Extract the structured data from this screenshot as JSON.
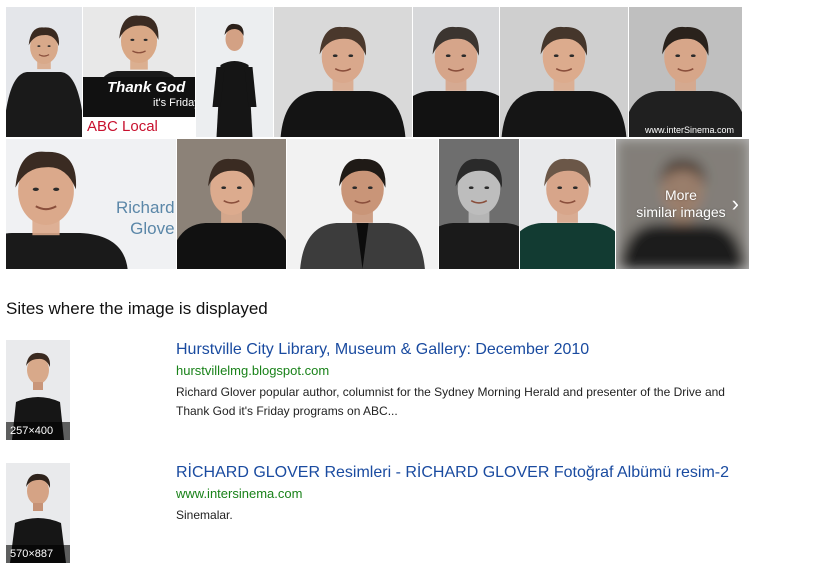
{
  "grid": {
    "row1": [
      {
        "bg": "#e4e6ea",
        "hair": "#3a2a20",
        "shirt": "#1a1a1a",
        "skin": "#d8a98a",
        "type": "half"
      },
      {
        "bg": "#e8e8e8",
        "hair": "#3b2b22",
        "shirt": "#1a1a1a",
        "skin": "#d9a886",
        "type": "abc",
        "overlay_title": "Thank God",
        "overlay_sub": "it's Friday",
        "overlay_logo": "ABC Local"
      },
      {
        "bg": "#eceef0",
        "hair": "#2c211b",
        "shirt": "#151515",
        "skin": "#d3a184",
        "type": "full"
      },
      {
        "bg": "#d9d9d9",
        "hair": "#4a382c",
        "shirt": "#141414",
        "skin": "#d9a88c",
        "type": "close"
      },
      {
        "bg": "#d7d8da",
        "hair": "#3c3530",
        "shirt": "#121212",
        "skin": "#d6a58a",
        "type": "close"
      },
      {
        "bg": "#cfcfcf",
        "hair": "#45362b",
        "shirt": "#151515",
        "skin": "#dcab8d",
        "type": "close"
      },
      {
        "bg": "#bfbfbf",
        "hair": "#2a221c",
        "shirt": "#202020",
        "skin": "#d7a689",
        "type": "close",
        "watermark": "www.interSinema.com"
      }
    ],
    "row2": [
      {
        "bg": "#f0f1f3",
        "hair": "#3a2b22",
        "shirt": "#1a1a1a",
        "skin": "#dba98b",
        "type": "name",
        "name_text": "Richard\nGlove"
      },
      {
        "bg": "#8c8278",
        "hair": "#3a2b22",
        "shirt": "#111111",
        "skin": "#dcab8e",
        "type": "close"
      },
      {
        "bg": "#f2f2f2",
        "hair": "#1f1a16",
        "shirt": "#3c3c3c",
        "skin": "#c99578",
        "type": "suit"
      },
      {
        "bg": "#6e6e6e",
        "hair": "#2a2a2a",
        "shirt": "#1a1a1a",
        "skin": "#bdbdbd",
        "type": "close"
      },
      {
        "bg": "#e9eaec",
        "hair": "#6b5748",
        "shirt": "#123b32",
        "skin": "#d7a58a",
        "type": "close"
      },
      {
        "bg": "#9a958f",
        "hair": "#5a4a3e",
        "shirt": "#222222",
        "skin": "#b89680",
        "type": "more",
        "more_label_1": "More",
        "more_label_2": "similar images"
      }
    ]
  },
  "section": {
    "heading": "Sites where the image is displayed"
  },
  "results": [
    {
      "title": "Hurstville City Library, Museum & Gallery: December 2010",
      "url": "hurstvillelmg.blogspot.com",
      "snippet": "Richard Glover popular author, columnist for the Sydney Morning Herald and presenter of the Drive and Thank God it's Friday programs on ABC...",
      "dims": "257×400"
    },
    {
      "title": "RİCHARD GLOVER Resimleri - RİCHARD GLOVER Fotoğraf Albümü resim-2",
      "url": "www.intersinema.com",
      "snippet": "Sinemalar.",
      "dims": "570×887"
    }
  ],
  "colors": {
    "link": "#1a4ba0",
    "url": "#198219"
  }
}
